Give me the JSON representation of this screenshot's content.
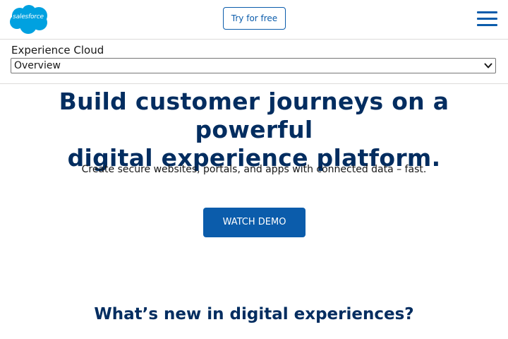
{
  "header": {
    "logo_text": "salesforce",
    "try_label": "Try for free"
  },
  "subnav": {
    "product": "Experience Cloud",
    "selected_section": "Overview"
  },
  "hero": {
    "title_line1": "Build customer journeys on a powerful",
    "title_line2": "digital experience platform.",
    "subtitle": "Create secure websites, portals, and apps with connected data – fast.",
    "cta_label": "WATCH DEMO"
  },
  "next_section": {
    "heading": "What’s new in digital experiences?"
  },
  "colors": {
    "brand_blue": "#0b5cab",
    "heading_navy": "#032d60",
    "logo_cloud": "#00a1e0"
  },
  "icons": {
    "logo": "salesforce-cloud-logo",
    "menu": "hamburger-menu-icon",
    "select": "chevron-down-icon"
  }
}
